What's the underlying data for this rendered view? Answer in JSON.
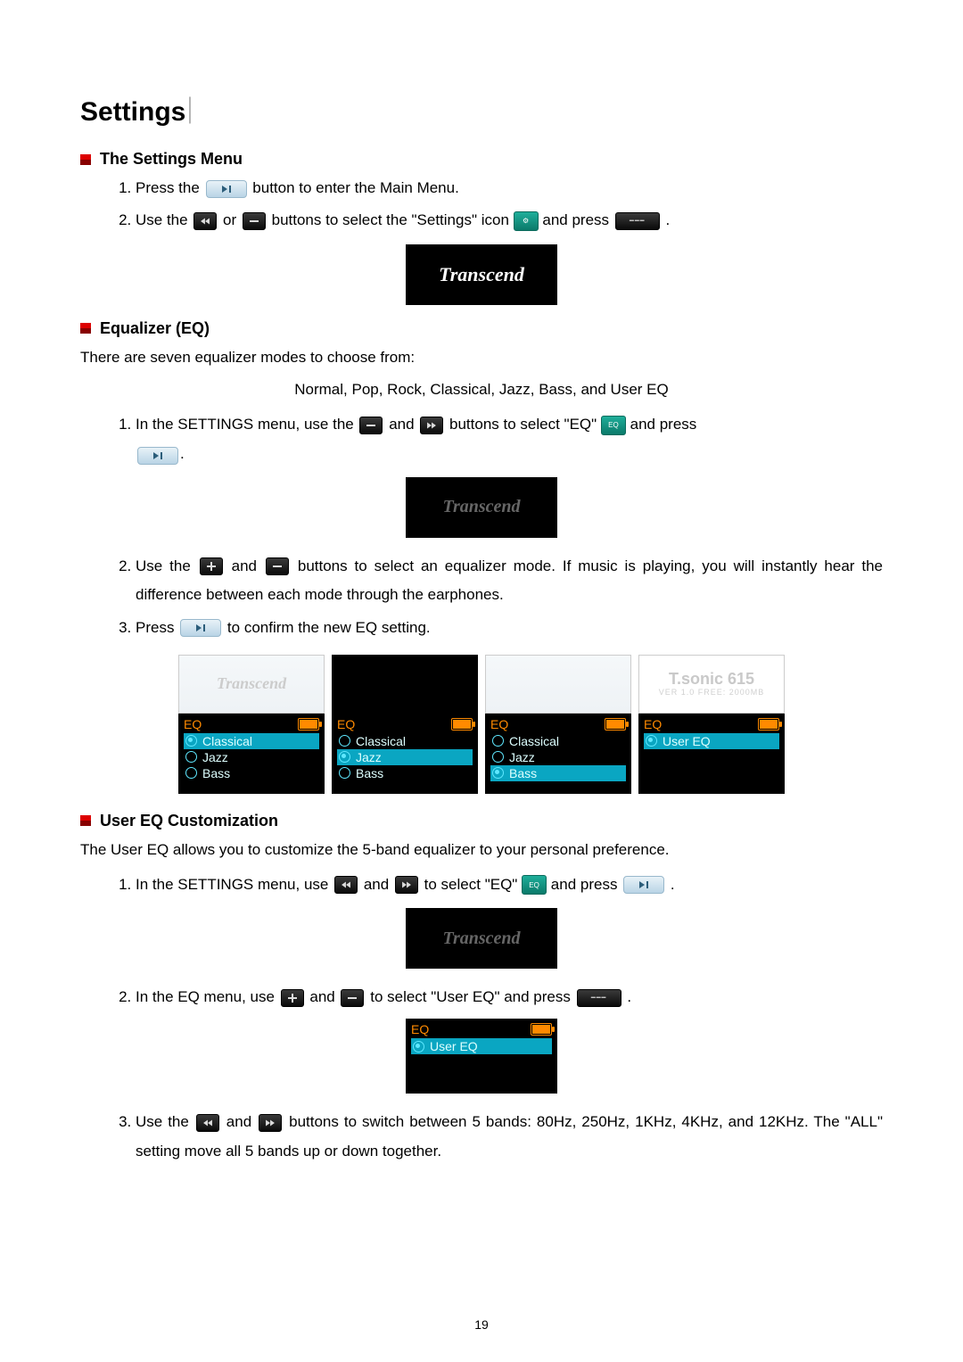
{
  "title": "Settings",
  "sections": {
    "menu": {
      "heading": "The Settings Menu",
      "steps": [
        {
          "pre": "Press the ",
          "post": " button to enter the Main Menu."
        },
        {
          "pre": "Use the ",
          "mid1": " or ",
          "mid2": " buttons to select the \"Settings\" icon ",
          "mid3": " and press ",
          "post": "."
        }
      ]
    },
    "eq": {
      "heading": "Equalizer (EQ)",
      "intro": "There are seven equalizer modes to choose from:",
      "modes": "Normal, Pop, Rock, Classical, Jazz, Bass, and User EQ",
      "steps": {
        "s1a": "In the SETTINGS menu, use the ",
        "s1b": " and ",
        "s1c": " buttons to select \"EQ\" ",
        "s1d": " and press ",
        "s1e": ".",
        "s2": "Use the ",
        "s2b": " and ",
        "s2c": " buttons to select an equalizer mode. If music is playing, you will instantly hear the difference between each mode through the earphones.",
        "s3a": "Press ",
        "s3b": " to confirm the new EQ setting."
      }
    },
    "usereq": {
      "heading": "User EQ Customization",
      "intro": "The User EQ allows you to customize the 5-band equalizer to your personal preference.",
      "steps": {
        "s1a": "In the SETTINGS menu, use ",
        "s1b": " and ",
        "s1c": " to select \"EQ\" ",
        "s1d": " and press ",
        "s1e": ".",
        "s2a": "In the EQ menu, use ",
        "s2b": " and ",
        "s2c": " to select \"User EQ\" and press ",
        "s2d": ".",
        "s3": "Use the ",
        "s3b": " and ",
        "s3c": " buttons to switch between 5 bands: 80Hz, 250Hz, 1KHz, 4KHz, and 12KHz. The \"ALL\" setting move all 5 bands up or down together."
      }
    }
  },
  "lcd": {
    "transcend": "Transcend",
    "tsonic": "T.sonic 615",
    "tsonic_sub": "VER 1.0   FREE: 2000MB"
  },
  "eq_panels": [
    {
      "items": [
        "Classical",
        "Jazz",
        "Bass"
      ],
      "selected": 0,
      "ticked": 0,
      "top": "wash"
    },
    {
      "items": [
        "Classical",
        "Jazz",
        "Bass"
      ],
      "selected": 1,
      "ticked": 1,
      "top": "black"
    },
    {
      "items": [
        "Classical",
        "Jazz",
        "Bass"
      ],
      "selected": 2,
      "ticked": 2,
      "top": "wash"
    },
    {
      "items": [
        "User EQ"
      ],
      "selected": 0,
      "ticked": 0,
      "top": "tsonic"
    }
  ],
  "eq_label": "EQ",
  "usereq_panel": {
    "label": "EQ",
    "item": "User EQ"
  },
  "page_number": "19"
}
